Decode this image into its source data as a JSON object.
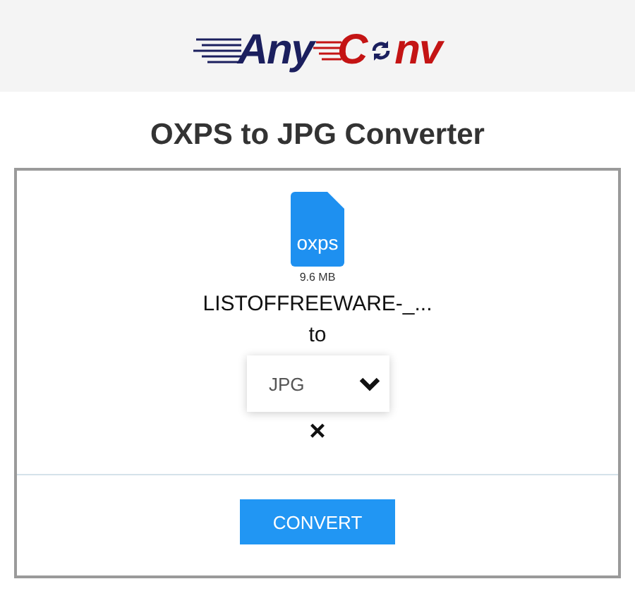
{
  "logo": {
    "part_1": "Any",
    "part_2": "C",
    "part_3": "nv"
  },
  "title": "OXPS to JPG Converter",
  "file": {
    "extension": "oxps",
    "size": "9.6 MB",
    "name": "LISTOFFREEWARE-_..."
  },
  "to_label": "to",
  "format_select": {
    "value": "JPG"
  },
  "remove": "×",
  "convert_button": "CONVERT"
}
